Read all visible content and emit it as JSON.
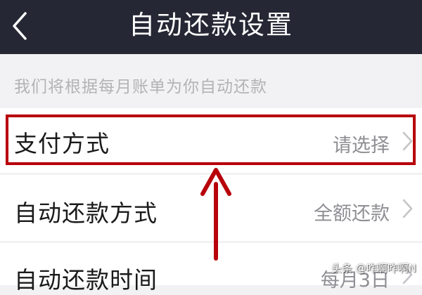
{
  "header": {
    "title": "自动还款设置",
    "back_icon": "chevron-left-icon"
  },
  "intro": {
    "text": "我们将根据每月账单为你自动还款"
  },
  "settings": {
    "items": [
      {
        "label": "支付方式",
        "value": "请选择"
      },
      {
        "label": "自动还款方式",
        "value": "全额还款"
      },
      {
        "label": "自动还款时间",
        "value": "每月3日"
      }
    ]
  },
  "annotation": {
    "highlight_color": "#b8000a",
    "arrow_color": "#b8000a"
  },
  "watermark": {
    "text": "头条 @咋啊咋啊N"
  },
  "colors": {
    "navbar": "#252734",
    "background": "#f2f2f4",
    "row": "#ffffff"
  }
}
